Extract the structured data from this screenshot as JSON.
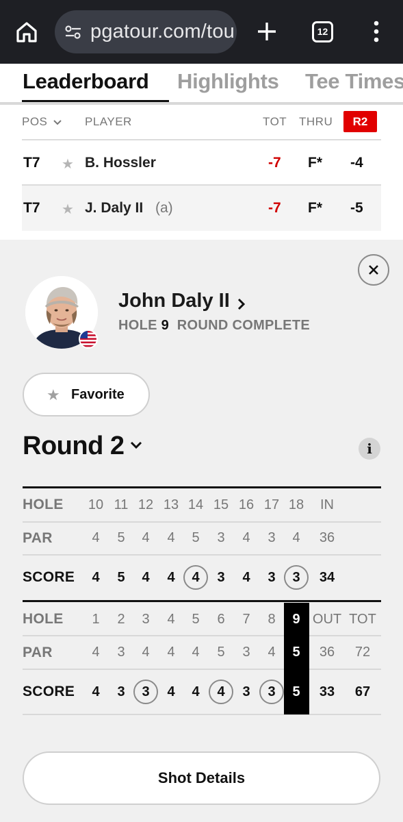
{
  "browser": {
    "url": "pgatour.com/tou",
    "tab_count": "12",
    "icons": [
      "home-icon",
      "site-settings-icon",
      "new-tab-icon",
      "tab-switcher-icon",
      "more-menu-icon"
    ]
  },
  "tabs": [
    {
      "label": "Leaderboard",
      "active": true
    },
    {
      "label": "Highlights",
      "active": false
    },
    {
      "label": "Tee Times",
      "active": false
    }
  ],
  "leaderboard": {
    "headers": {
      "pos": "POS",
      "player": "PLAYER",
      "tot": "TOT",
      "thru": "THRU",
      "round": "R2"
    },
    "rows": [
      {
        "pos": "T7",
        "name": "B. Hossler",
        "amateur": "",
        "tot": "-7",
        "thru": "F*",
        "round": "-4"
      },
      {
        "pos": "T7",
        "name": "J. Daly II",
        "amateur": "(a)",
        "tot": "-7",
        "thru": "F*",
        "round": "-5"
      }
    ]
  },
  "player": {
    "name": "John Daly II",
    "hole_label": "HOLE",
    "hole": "9",
    "status": "ROUND COMPLETE",
    "favorite_label": "Favorite"
  },
  "round": {
    "title": "Round 2",
    "info": "i"
  },
  "scorecard": {
    "back": {
      "labels": {
        "hole": "HOLE",
        "par": "PAR",
        "score": "SCORE"
      },
      "holes": [
        "10",
        "11",
        "12",
        "13",
        "14",
        "15",
        "16",
        "17",
        "18"
      ],
      "par": [
        "4",
        "5",
        "4",
        "4",
        "5",
        "3",
        "4",
        "3",
        "4"
      ],
      "score": [
        "4",
        "5",
        "4",
        "4",
        "4",
        "3",
        "4",
        "3",
        "3"
      ],
      "total_label": "IN",
      "par_total": "36",
      "score_total": "34"
    },
    "front": {
      "labels": {
        "hole": "HOLE",
        "par": "PAR",
        "score": "SCORE"
      },
      "holes": [
        "1",
        "2",
        "3",
        "4",
        "5",
        "6",
        "7",
        "8",
        "9"
      ],
      "par": [
        "4",
        "3",
        "4",
        "4",
        "4",
        "5",
        "3",
        "4",
        "5"
      ],
      "score": [
        "4",
        "3",
        "3",
        "4",
        "4",
        "4",
        "3",
        "3",
        "5"
      ],
      "out_label": "OUT",
      "tot_label": "TOT",
      "par_out": "36",
      "par_tot": "72",
      "score_out": "33",
      "score_tot": "67",
      "current_hole": "9"
    }
  },
  "shot_details_label": "Shot Details",
  "colors": {
    "accent_red": "#e10000",
    "under_par_red": "#d00000",
    "browser_bar": "#1e1f24"
  }
}
